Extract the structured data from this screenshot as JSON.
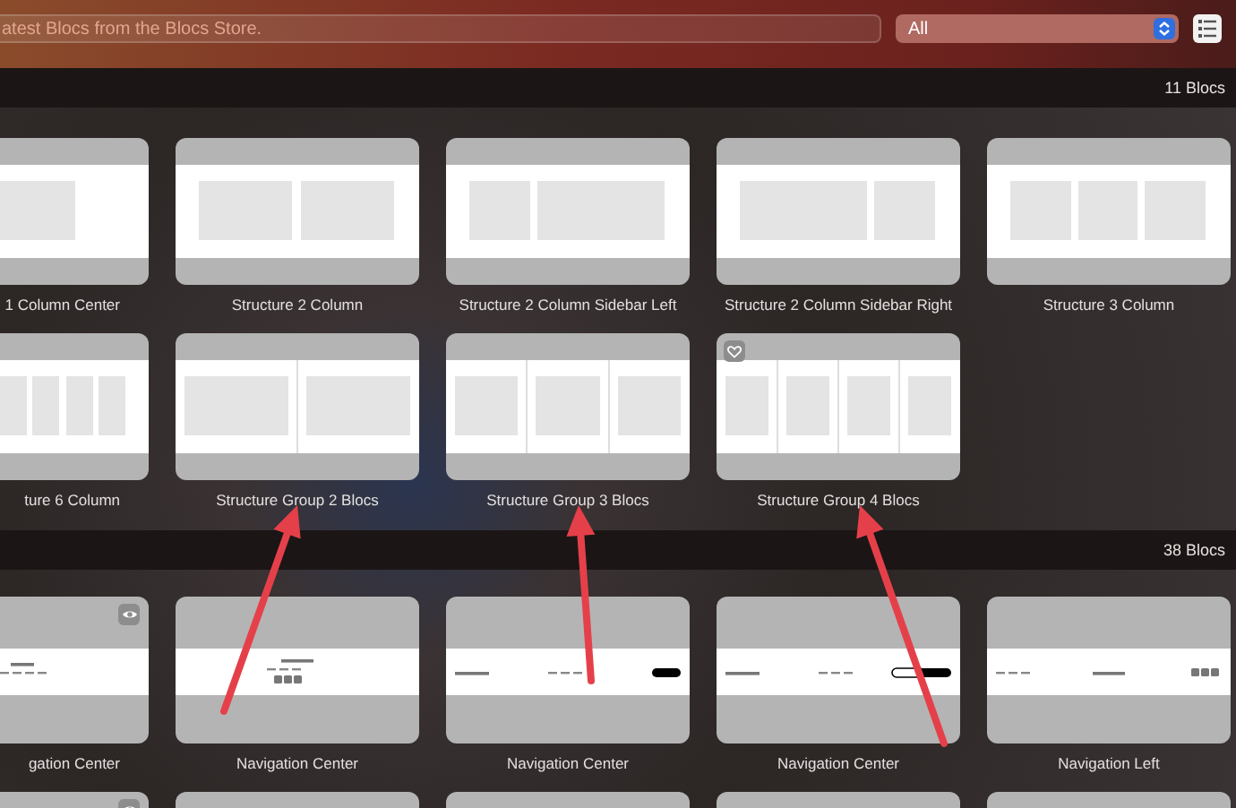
{
  "toolbar": {
    "search": {
      "placeholder": "atest Blocs from the Blocs Store."
    },
    "filter": {
      "value": "All"
    }
  },
  "sections": [
    {
      "count": "11 Blocs",
      "cards": [
        {
          "label": "1 Column Center",
          "kind": "one-column",
          "favorite": false,
          "preview": false
        },
        {
          "label": "Structure 2 Column",
          "kind": "two-column",
          "favorite": false,
          "preview": false
        },
        {
          "label": "Structure 2 Column Sidebar Left",
          "kind": "sidebar-left",
          "favorite": false,
          "preview": false
        },
        {
          "label": "Structure 2 Column Sidebar Right",
          "kind": "sidebar-right",
          "favorite": false,
          "preview": false
        },
        {
          "label": "Structure 3 Column",
          "kind": "three-column",
          "favorite": false,
          "preview": false
        },
        {
          "label": "ture 6 Column",
          "kind": "six-column",
          "favorite": false,
          "preview": false
        },
        {
          "label": "Structure Group 2 Blocs",
          "kind": "group-2",
          "favorite": false,
          "preview": false
        },
        {
          "label": "Structure Group 3 Blocs",
          "kind": "group-3",
          "favorite": false,
          "preview": false
        },
        {
          "label": "Structure Group 4 Blocs",
          "kind": "group-4",
          "favorite": true,
          "preview": false
        }
      ]
    },
    {
      "count": "38 Blocs",
      "cards": [
        {
          "label": "gation Center",
          "kind": "nav-stacked",
          "favorite": false,
          "preview": true
        },
        {
          "label": "Navigation Center",
          "kind": "nav-social",
          "favorite": false,
          "preview": false
        },
        {
          "label": "Navigation Center",
          "kind": "nav-pill",
          "favorite": false,
          "preview": false
        },
        {
          "label": "Navigation Center",
          "kind": "nav-two-pills",
          "favorite": false,
          "preview": false
        },
        {
          "label": "Navigation Left",
          "kind": "nav-left",
          "favorite": false,
          "preview": false
        },
        {
          "kind": "cut",
          "favorite": false,
          "preview": true
        },
        {
          "kind": "cut",
          "favorite": false,
          "preview": false
        },
        {
          "kind": "cut",
          "favorite": false,
          "preview": false
        },
        {
          "kind": "cut",
          "favorite": false,
          "preview": false
        },
        {
          "kind": "cut",
          "favorite": false,
          "preview": false
        }
      ]
    }
  ]
}
